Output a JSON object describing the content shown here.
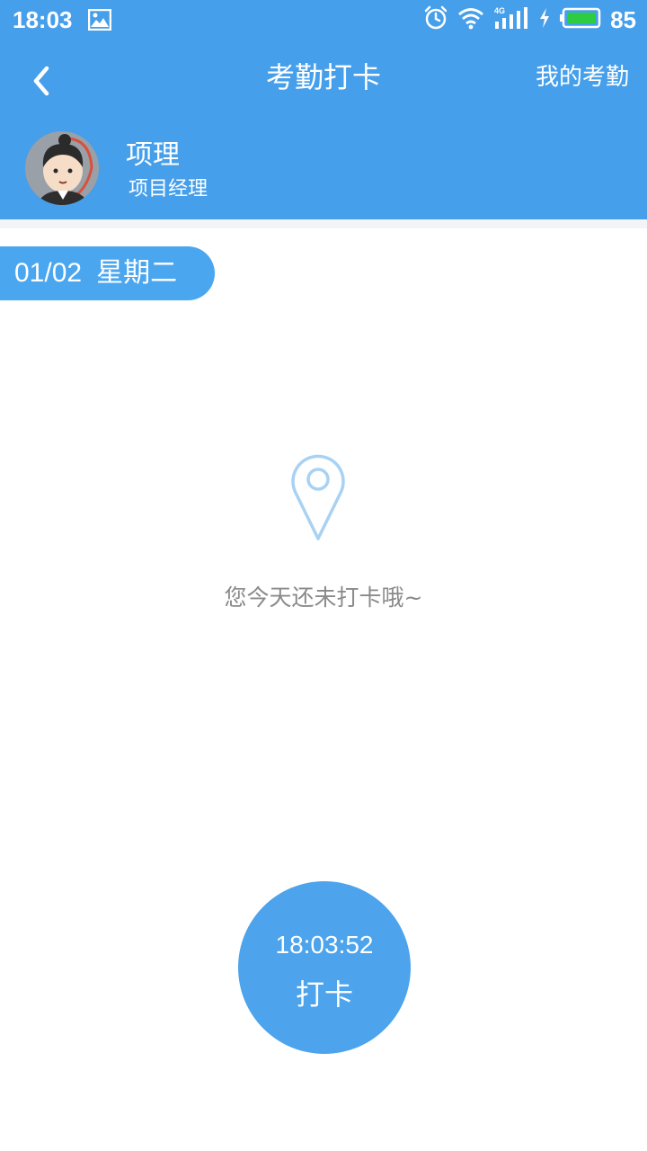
{
  "status_bar": {
    "time": "18:03",
    "battery_percent": "85",
    "network_label": "4G",
    "icons": [
      "gallery-icon",
      "alarm-icon",
      "wifi-icon",
      "signal-icon",
      "charging-icon",
      "battery-icon"
    ]
  },
  "navbar": {
    "title": "考勤打卡",
    "right_link": "我的考勤",
    "back_icon": "chevron-left-icon"
  },
  "user": {
    "name": "项理",
    "role": "项目经理"
  },
  "date": {
    "day": "01/02",
    "weekday": "星期二"
  },
  "empty_state": {
    "icon": "location-pin-icon",
    "message": "您今天还未打卡哦~"
  },
  "punch_button": {
    "time": "18:03:52",
    "label": "打卡"
  },
  "colors": {
    "header": "#469fea",
    "accent": "#4da3ec",
    "pin": "#a8d2f4",
    "muted_text": "#8a8a8a",
    "battery_fill": "#2ecc40"
  }
}
